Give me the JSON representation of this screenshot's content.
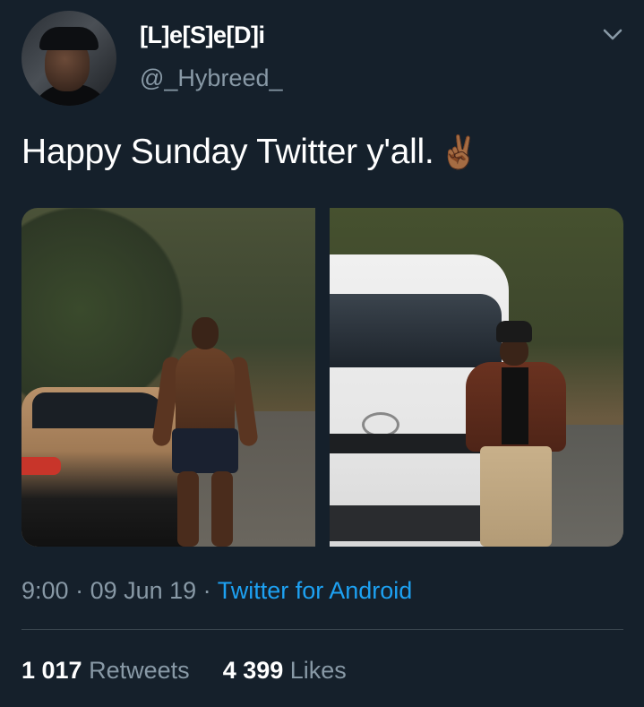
{
  "user": {
    "display_name": "[L]e[S]e[D]i",
    "handle": "@_Hybreed_"
  },
  "tweet": {
    "text": "Happy Sunday Twitter y'all.",
    "emoji": "✌🏾",
    "images": [
      "photo-shirtless-by-car",
      "photo-leather-jacket-by-van"
    ]
  },
  "meta": {
    "time": "9:00",
    "separator": " · ",
    "date": "09 Jun 19",
    "source": "Twitter for Android"
  },
  "stats": {
    "retweets_count": "1 017",
    "retweets_label": "Retweets",
    "likes_count": "4 399",
    "likes_label": "Likes"
  },
  "icons": {
    "menu": "chevron-down-icon"
  },
  "colors": {
    "background": "#15202b",
    "secondary_text": "#8899a6",
    "link": "#1da1f2",
    "divider": "#38444d"
  }
}
